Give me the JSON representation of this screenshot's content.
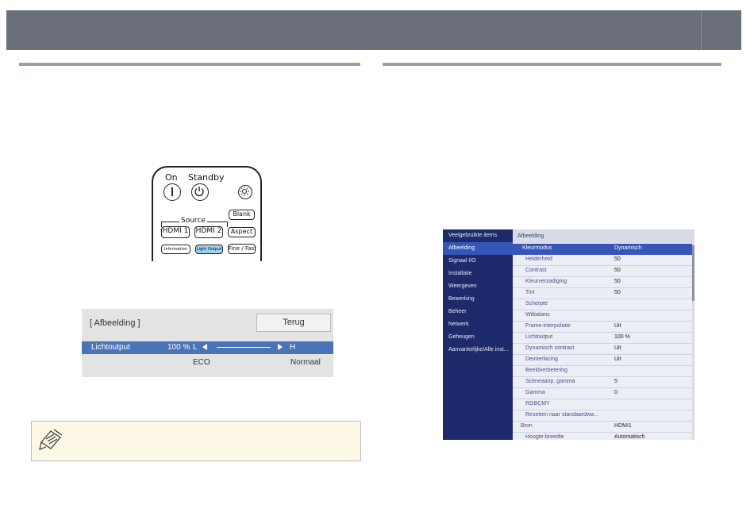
{
  "remote": {
    "on": "On",
    "standby": "Standby",
    "source": "Source",
    "blank": "Blank",
    "hdmi1": "HDMI 1",
    "hdmi2": "HDMI 2",
    "aspect": "Aspect",
    "information": "Information",
    "light_output": "Light Output",
    "fine_fast": "Fine / Fast",
    "power_icon": "power-icon",
    "standby_icon": "standby-power-icon",
    "light_icon": "light-sun-icon"
  },
  "dialog": {
    "title": "[ Afbeelding ]",
    "back": "Terug",
    "row_label": "Lichtoutput",
    "row_value": "100 %",
    "low": "L",
    "high": "H",
    "eco": "ECO",
    "normal": "Normaal"
  },
  "note": {
    "icon": "note-pencil-icon"
  },
  "menu": {
    "sidebar": [
      {
        "label": "Veelgebruikte items"
      },
      {
        "label": "Afbeelding"
      },
      {
        "label": "Signaal I/O"
      },
      {
        "label": "Installatie"
      },
      {
        "label": "Weergeven"
      },
      {
        "label": "Bewerking"
      },
      {
        "label": "Beheer"
      },
      {
        "label": "Netwerk"
      },
      {
        "label": "Geheugen"
      },
      {
        "label": "Aanvankelijke/Alle inst..."
      }
    ],
    "header": "Afbeelding",
    "rows": [
      {
        "label": "Kleurmodus",
        "value": "Dynamisch"
      },
      {
        "label": "Helderheid",
        "value": "50"
      },
      {
        "label": "Contrast",
        "value": "50"
      },
      {
        "label": "Kleurverzadiging",
        "value": "50"
      },
      {
        "label": "Tint",
        "value": "50"
      },
      {
        "label": "Scherpte",
        "value": ""
      },
      {
        "label": "Witbalans",
        "value": ""
      },
      {
        "label": "Frame-interpolatie",
        "value": "Uit"
      },
      {
        "label": "Lichtoutput",
        "value": "100 %"
      },
      {
        "label": "Dynamisch contrast",
        "value": "Uit"
      },
      {
        "label": "Deinterlacing",
        "value": "Uit"
      },
      {
        "label": "Beeldverbetering",
        "value": ""
      },
      {
        "label": "Scèneaanp. gamma",
        "value": "5"
      },
      {
        "label": "Gamma",
        "value": "0"
      },
      {
        "label": "RGBCMY",
        "value": ""
      },
      {
        "label": "Resetten naar standaardwa...",
        "value": ""
      },
      {
        "label": "Bron",
        "value": "HDMI1"
      },
      {
        "label": "Hoogte-breedte",
        "value": "Automatisch"
      }
    ]
  }
}
